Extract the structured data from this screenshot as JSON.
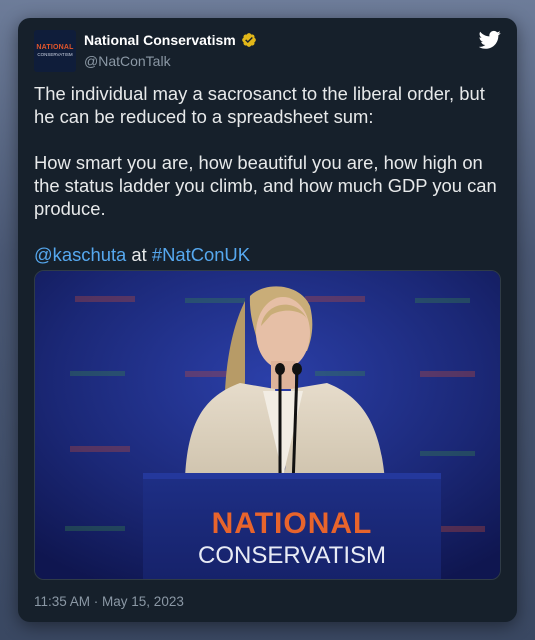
{
  "author": {
    "name": "National Conservatism",
    "handle": "@NatConTalk",
    "avatar_line1": "NATIONAL",
    "avatar_line2": "CONSERVATISM"
  },
  "tweet": {
    "paragraph1": "The individual may a sacrosanct to the liberal order, but he can be reduced to a spreadsheet sum:",
    "paragraph2": "How smart you are, how beautiful you are, how high on the status ladder you climb, and how much GDP you can produce.",
    "mention": "@kaschuta",
    "connector": " at ",
    "hashtag": "#NatConUK"
  },
  "media": {
    "podium_line1": "NATIONAL",
    "podium_line2": "CONSERVATISM"
  },
  "timestamp": "11:35 AM · May 15, 2023",
  "colors": {
    "card_bg": "#16202b",
    "link": "#56a8ef",
    "twitter_blue": "#1d9bf0",
    "verified_gold": "#e2b719",
    "podium_orange": "#e8642c"
  },
  "icons": {
    "verified": "verified-badge-icon",
    "brand": "twitter-bird-icon"
  }
}
